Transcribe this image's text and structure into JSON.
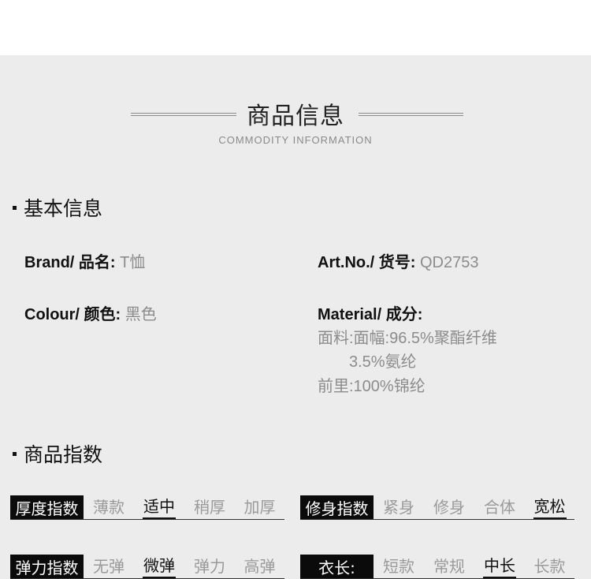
{
  "header": {
    "title": "商品信息",
    "subtitle": "COMMODITY INFORMATION"
  },
  "basic_info": {
    "heading": "基本信息",
    "brand": {
      "label": "Brand/ 品名:",
      "value": "T恤"
    },
    "art_no": {
      "label": "Art.No./ 货号:",
      "value": "QD2753"
    },
    "colour": {
      "label": "Colour/ 颜色:",
      "value": "黑色"
    },
    "material": {
      "label": "Material/ 成分:",
      "lines": [
        "面料:面幅:96.5%聚酯纤维",
        "3.5%氨纶",
        "前里:100%锦纶"
      ]
    }
  },
  "indices": {
    "heading": "商品指数",
    "rows": [
      {
        "label": "厚度指数",
        "options": [
          "薄款",
          "适中",
          "稍厚",
          "加厚"
        ],
        "selected": "适中"
      },
      {
        "label": "修身指数",
        "options": [
          "紧身",
          "修身",
          "合体",
          "宽松"
        ],
        "selected": "宽松"
      },
      {
        "label": "弹力指数",
        "options": [
          "无弹",
          "微弹",
          "弹力",
          "高弹"
        ],
        "selected": "微弹"
      },
      {
        "label": "衣长:",
        "options": [
          "短款",
          "常规",
          "中长",
          "长款"
        ],
        "selected": "中长"
      }
    ]
  },
  "colors": {
    "panel_bg": "#ececec",
    "label_bg": "#0b0b0b",
    "muted_text": "#8c8c8c"
  }
}
